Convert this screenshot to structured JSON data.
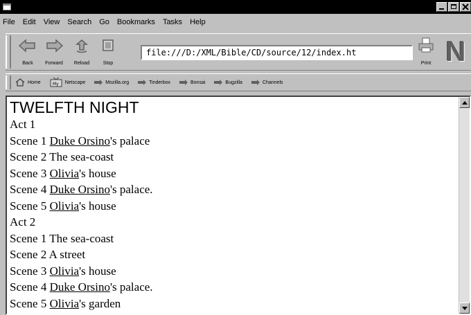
{
  "window": {
    "controls": [
      "minimize",
      "maximize",
      "close"
    ]
  },
  "menubar": {
    "items": [
      "File",
      "Edit",
      "View",
      "Search",
      "Go",
      "Bookmarks",
      "Tasks",
      "Help"
    ]
  },
  "toolbar": {
    "back_label": "Back",
    "forward_label": "Forward",
    "reload_label": "Reload",
    "stop_label": "Stop",
    "url": "file:///D:/XML/Bible/CD/source/12/index.ht",
    "print_label": "Print",
    "logo_letter": "N"
  },
  "personal_toolbar": {
    "items": [
      {
        "label": "Home",
        "icon": "home-icon"
      },
      {
        "label": "Netscape",
        "icon": "netscape-icon"
      },
      {
        "label": "Mozilla.org",
        "icon": "bookmark-arrow-icon"
      },
      {
        "label": "Tinderbox",
        "icon": "bookmark-arrow-icon"
      },
      {
        "label": "Bonsai",
        "icon": "bookmark-arrow-icon"
      },
      {
        "label": "Bugzilla",
        "icon": "bookmark-arrow-icon"
      },
      {
        "label": "Channels",
        "icon": "bookmark-arrow-icon"
      }
    ]
  },
  "document": {
    "title": "TWELFTH NIGHT",
    "lines": [
      {
        "text": "Act 1"
      },
      {
        "prefix": "Scene 1 ",
        "link": "Duke Orsino",
        "suffix": "'s palace"
      },
      {
        "text": "Scene 2 The sea-coast"
      },
      {
        "prefix": "Scene 3 ",
        "link": "Olivia",
        "suffix": "'s house"
      },
      {
        "prefix": "Scene 4 ",
        "link": "Duke Orsino",
        "suffix": "'s palace."
      },
      {
        "prefix": "Scene 5 ",
        "link": "Olivia",
        "suffix": "'s house"
      },
      {
        "text": "Act 2"
      },
      {
        "text": "Scene 1 The sea-coast"
      },
      {
        "text": "Scene 2 A street"
      },
      {
        "prefix": "Scene 3 ",
        "link": "Olivia",
        "suffix": "'s house"
      },
      {
        "prefix": "Scene 4 ",
        "link": "Duke Orsino",
        "suffix": "'s palace."
      },
      {
        "prefix": "Scene 5 ",
        "link": "Olivia",
        "suffix": "'s garden"
      }
    ]
  }
}
